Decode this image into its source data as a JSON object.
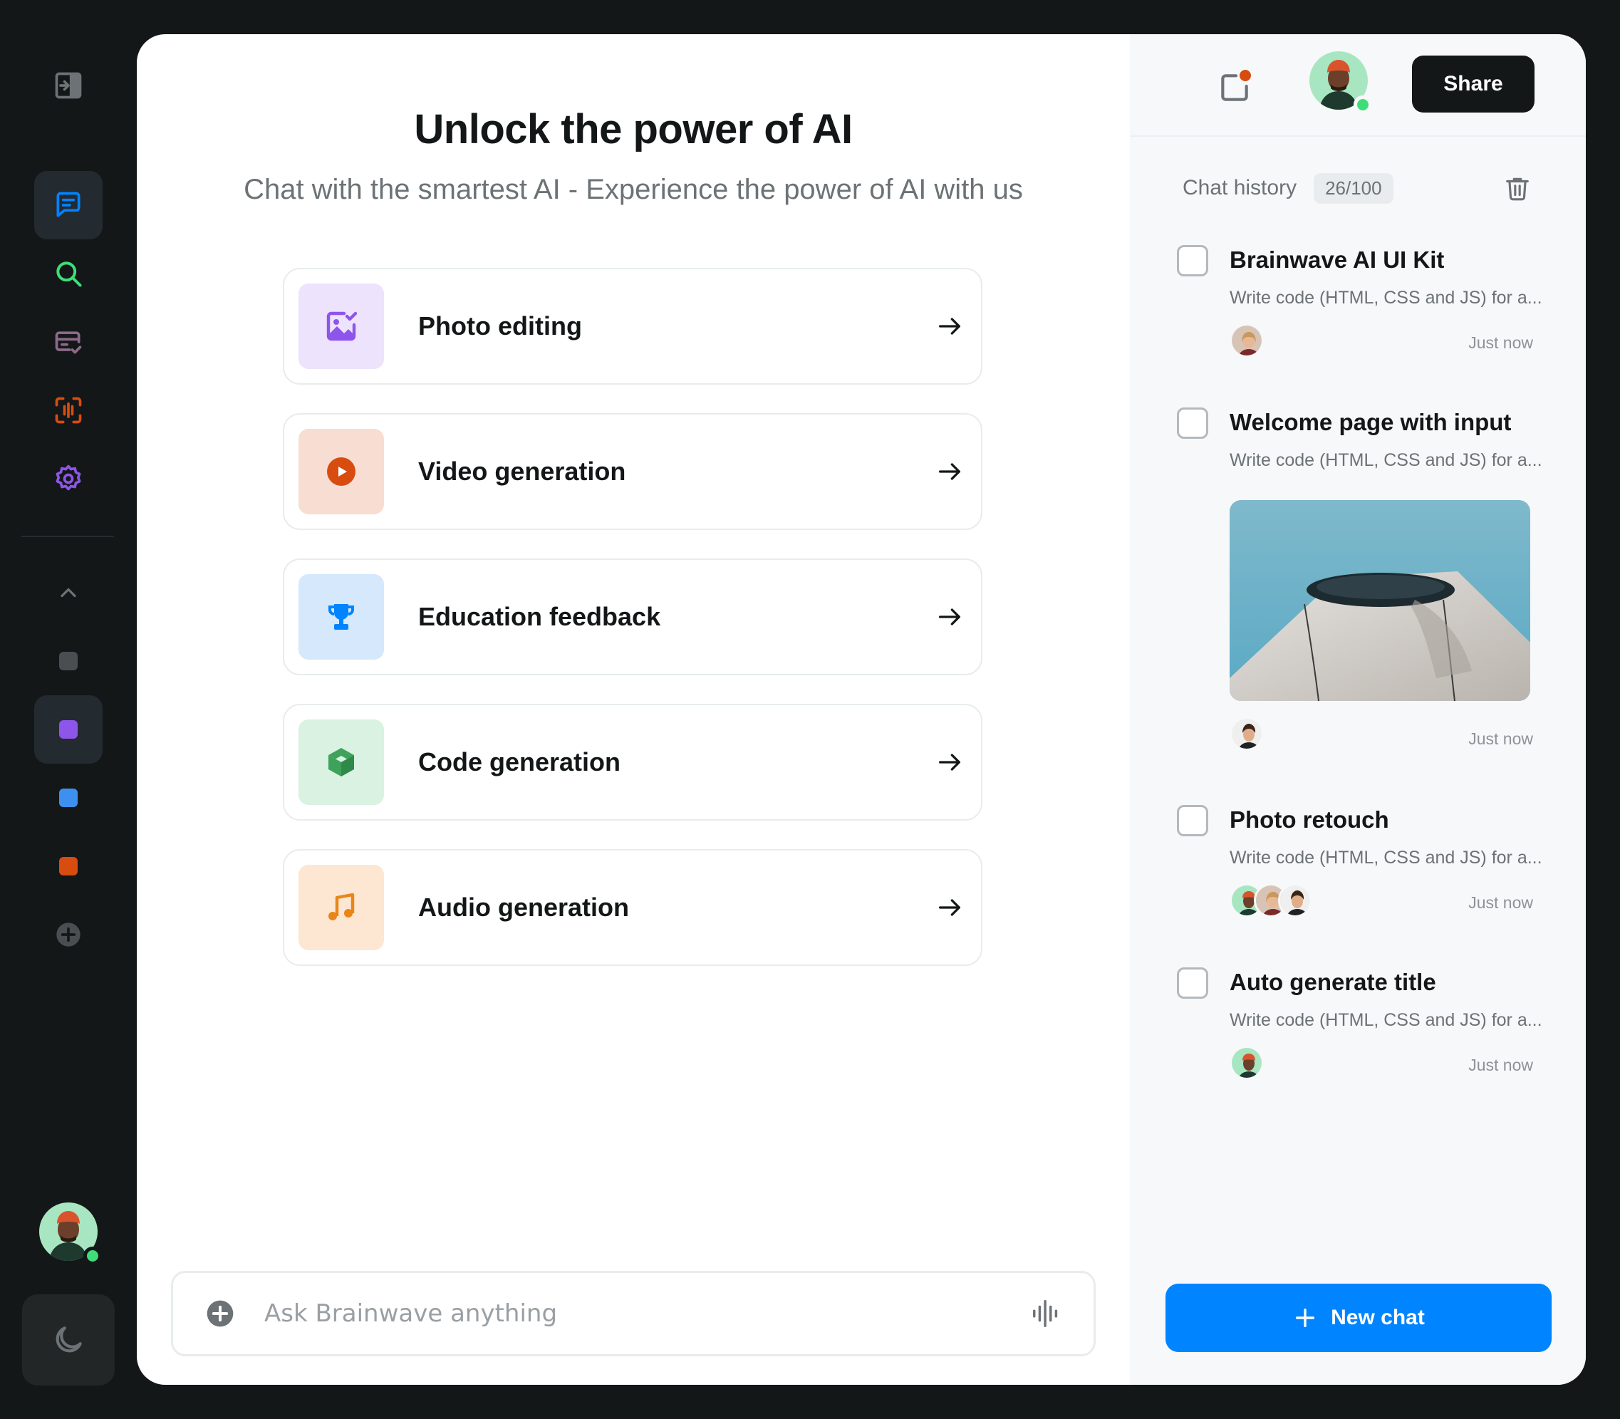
{
  "colors": {
    "background": "#141718",
    "panel": "#ffffff",
    "accent": "#0084ff",
    "online": "#3fdd78",
    "notification": "#d84c10"
  },
  "rail": {
    "items": [
      {
        "icon": "sidebar-toggle-icon"
      },
      {
        "icon": "chat-icon",
        "active": true
      },
      {
        "icon": "search-icon"
      },
      {
        "icon": "card-check-icon"
      },
      {
        "icon": "scan-icon"
      },
      {
        "icon": "gear-icon"
      }
    ],
    "folders": [
      {
        "icon": "chevron-up-icon"
      },
      {
        "color": "#4a4e52"
      },
      {
        "color": "#8e55ea",
        "active": true
      },
      {
        "color": "#3e90f0"
      },
      {
        "color": "#d84c10"
      },
      {
        "icon": "plus-circle-icon"
      }
    ],
    "theme_icon": "moon-icon"
  },
  "main": {
    "title": "Unlock the power of AI",
    "subtitle": "Chat with the smartest AI - Experience the power of AI with us",
    "cards": [
      {
        "label": "Photo editing",
        "icon": "image-edit-icon",
        "bg": "#ede3fd",
        "fg": "#8e55ea"
      },
      {
        "label": "Video generation",
        "icon": "play-circle-icon",
        "bg": "#f7ddd2",
        "fg": "#d84c10"
      },
      {
        "label": "Education feedback",
        "icon": "trophy-icon",
        "bg": "#d5e8fc",
        "fg": "#0084ff"
      },
      {
        "label": "Code generation",
        "icon": "cube-icon",
        "bg": "#d9f2e1",
        "fg": "#3fa25b"
      },
      {
        "label": "Audio generation",
        "icon": "music-note-icon",
        "bg": "#fde6d2",
        "fg": "#e8861a"
      }
    ],
    "composer": {
      "placeholder": "Ask Brainwave anything"
    }
  },
  "sidebar": {
    "share_label": "Share",
    "history_title": "Chat history",
    "history_count": "26/100",
    "chats": [
      {
        "title": "Brainwave AI UI Kit",
        "snippet": "Write code (HTML, CSS and JS) for a...",
        "time": "Just now"
      },
      {
        "title": "Welcome page with input",
        "snippet": "Write code (HTML, CSS and JS) for a...",
        "time": "Just now"
      },
      {
        "title": "Photo retouch",
        "snippet": "Write code (HTML, CSS and JS) for a...",
        "time": "Just now"
      },
      {
        "title": "Auto generate title",
        "snippet": "Write code (HTML, CSS and JS) for a...",
        "time": "Just now"
      }
    ],
    "new_chat_label": "New chat"
  }
}
